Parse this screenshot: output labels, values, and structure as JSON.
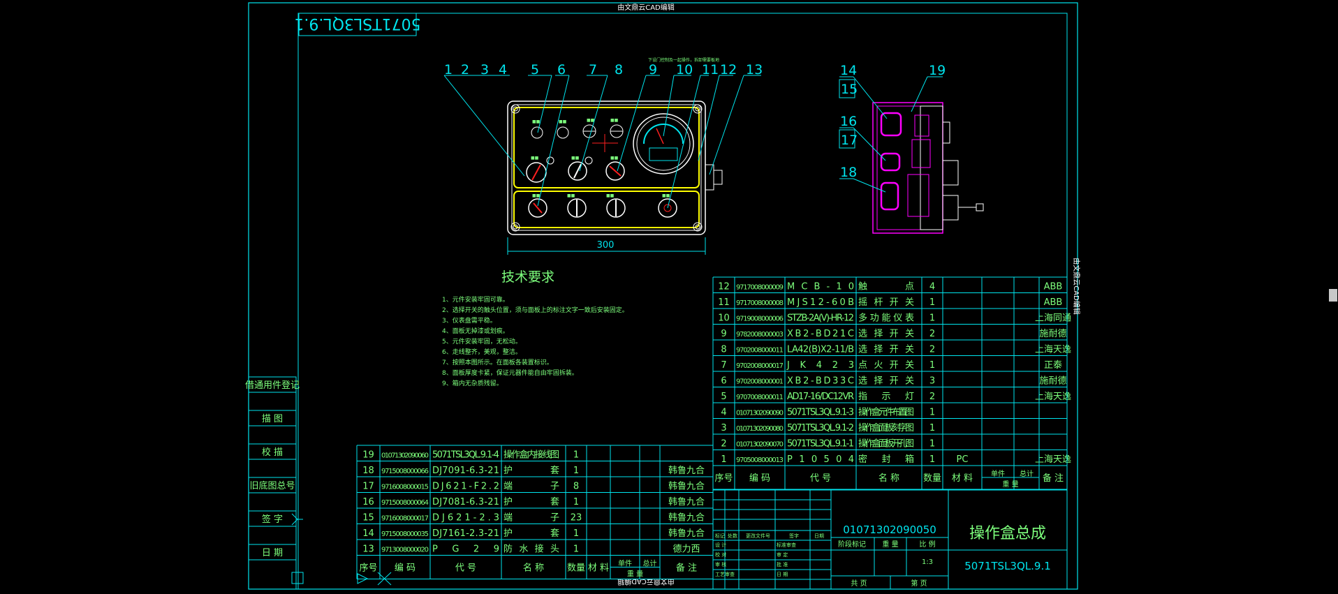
{
  "watermark": "由文鼎云CAD编辑",
  "drawing_code_rotated": "5071TSL3QL.9.1",
  "balloons_main": [
    "1",
    "2",
    "3",
    "4",
    "5",
    "6",
    "7",
    "8",
    "9",
    "10",
    "11",
    "12",
    "13"
  ],
  "balloons_side": [
    "14",
    "15",
    "16",
    "17",
    "18",
    "19"
  ],
  "dimension_width": "300",
  "tiny_note": "下设门控制及一起操作，拆卸需要板地",
  "tech_title": "技术要求",
  "tech_notes": [
    "1、元件安装牢固可靠。",
    "2、选择开关的触头位置，须与面板上的标注文字一致后安装固定。",
    "3、仪表盘需平稳。",
    "4、面板无掉漆或划痕。",
    "5、元件安装牢固，无松动。",
    "6、走线整齐，美观，整洁。",
    "7、按照本图所示。在面板各装置标识。",
    "8、面板厚度卡紧，保证元器件能自由牢固拆装。",
    "9、箱内无杂质残留。"
  ],
  "left_strip": [
    "借通用件登记",
    "描 图",
    "校 描",
    "旧底图总号",
    "签 字",
    "日 期"
  ],
  "upper_table": {
    "rows": [
      [
        "12",
        "9717008000009",
        "MCB-10",
        "触点",
        "4",
        "",
        "",
        "",
        "ABB"
      ],
      [
        "11",
        "9717008000008",
        "MJS12-60B",
        "摇杆开关",
        "1",
        "",
        "",
        "",
        "ABB"
      ],
      [
        "10",
        "9719008000006",
        "STZB-2A(V)-HR-12",
        "多功能仪表",
        "1",
        "",
        "",
        "",
        "上海同通"
      ],
      [
        "9",
        "9782008000003",
        "XB2-BD21C",
        "选择开关",
        "2",
        "",
        "",
        "",
        "施耐德"
      ],
      [
        "8",
        "9702008000011",
        "LA42(B)X2-11/B",
        "选择开关",
        "2",
        "",
        "",
        "",
        "上海天逸"
      ],
      [
        "7",
        "9702008000017",
        "JK423",
        "点火开关",
        "1",
        "",
        "",
        "",
        "正泰"
      ],
      [
        "6",
        "9702008000001",
        "XB2-BD33C",
        "选择开关",
        "3",
        "",
        "",
        "",
        "施耐德"
      ],
      [
        "5",
        "9707008000011",
        "AD17-16/DC12VR",
        "指示灯",
        "2",
        "",
        "",
        "",
        "上海天逸"
      ],
      [
        "4",
        "01071302090090",
        "5071TSL3QL.9.1-3",
        "操作盒元件布置图",
        "1",
        "",
        "",
        "",
        ""
      ],
      [
        "3",
        "01071302090080",
        "5071TSL3QL.9.1-2",
        "操作盒面板刻字图",
        "1",
        "",
        "",
        "",
        ""
      ],
      [
        "2",
        "01071302090070",
        "5071TSL3QL.9.1-1",
        "操作盒面板开孔图",
        "1",
        "",
        "",
        "",
        ""
      ],
      [
        "1",
        "9705008000013",
        "P10504",
        "密封箱",
        "1",
        "PC",
        "",
        "",
        "上海天逸"
      ]
    ],
    "header": [
      "序号",
      "编 码",
      "代 号",
      "名 称",
      "数量",
      "材 料",
      "单件",
      "总计",
      "备 注"
    ],
    "weight_label": "重 量"
  },
  "lower_table": {
    "rows": [
      [
        "19",
        "01071302090060",
        "5071TSL3QL.9.1-4",
        "操作盒内接线图",
        "1",
        "",
        "",
        "",
        ""
      ],
      [
        "18",
        "9715008000066",
        "DJ7091-6.3-21",
        "护套",
        "1",
        "",
        "",
        "",
        "韩鲁九合"
      ],
      [
        "17",
        "9716008000015",
        "DJ621-F2.2",
        "端子",
        "8",
        "",
        "",
        "",
        "韩鲁九合"
      ],
      [
        "16",
        "9715008000064",
        "DJ7081-6.3-21",
        "护套",
        "1",
        "",
        "",
        "",
        "韩鲁九合"
      ],
      [
        "15",
        "9716008000017",
        "DJ621-2.3",
        "端子",
        "23",
        "",
        "",
        "",
        "韩鲁九合"
      ],
      [
        "14",
        "9715008000035",
        "DJ7161-2.3-21",
        "护套",
        "1",
        "",
        "",
        "",
        "韩鲁九合"
      ],
      [
        "13",
        "9713008000020",
        "PG29",
        "防水接头",
        "1",
        "",
        "",
        "",
        "德力西"
      ]
    ],
    "header": [
      "序号",
      "编 码",
      "代 号",
      "名 称",
      "数量",
      "材 料",
      "单件",
      "总计",
      "备 注"
    ],
    "weight_label": "重 量"
  },
  "title_block": {
    "doc_code": "01071302090050",
    "part_name": "操作盒总成",
    "drawing_no": "5071TSL3QL.9.1",
    "stage_mark": "阶段标记",
    "weight": "重 量",
    "scale": "比 例",
    "scale_value": "1:3",
    "sheets_total": "共  页",
    "sheet_no": "第  页",
    "rev_headers": [
      "标记",
      "处数",
      "更改文件号",
      "签字",
      "日期"
    ],
    "roles": [
      "设 计",
      "校 对",
      "审 核",
      "工艺审查"
    ],
    "roles_right": [
      "标准审查",
      "审 定",
      "批 准",
      "日 期"
    ]
  },
  "colors": {
    "frame": "#00e5ee",
    "text": "#7dff7d",
    "yellow": "#ffff00",
    "white": "#ffffff",
    "magenta": "#ff00ff",
    "red": "#ff2020"
  }
}
